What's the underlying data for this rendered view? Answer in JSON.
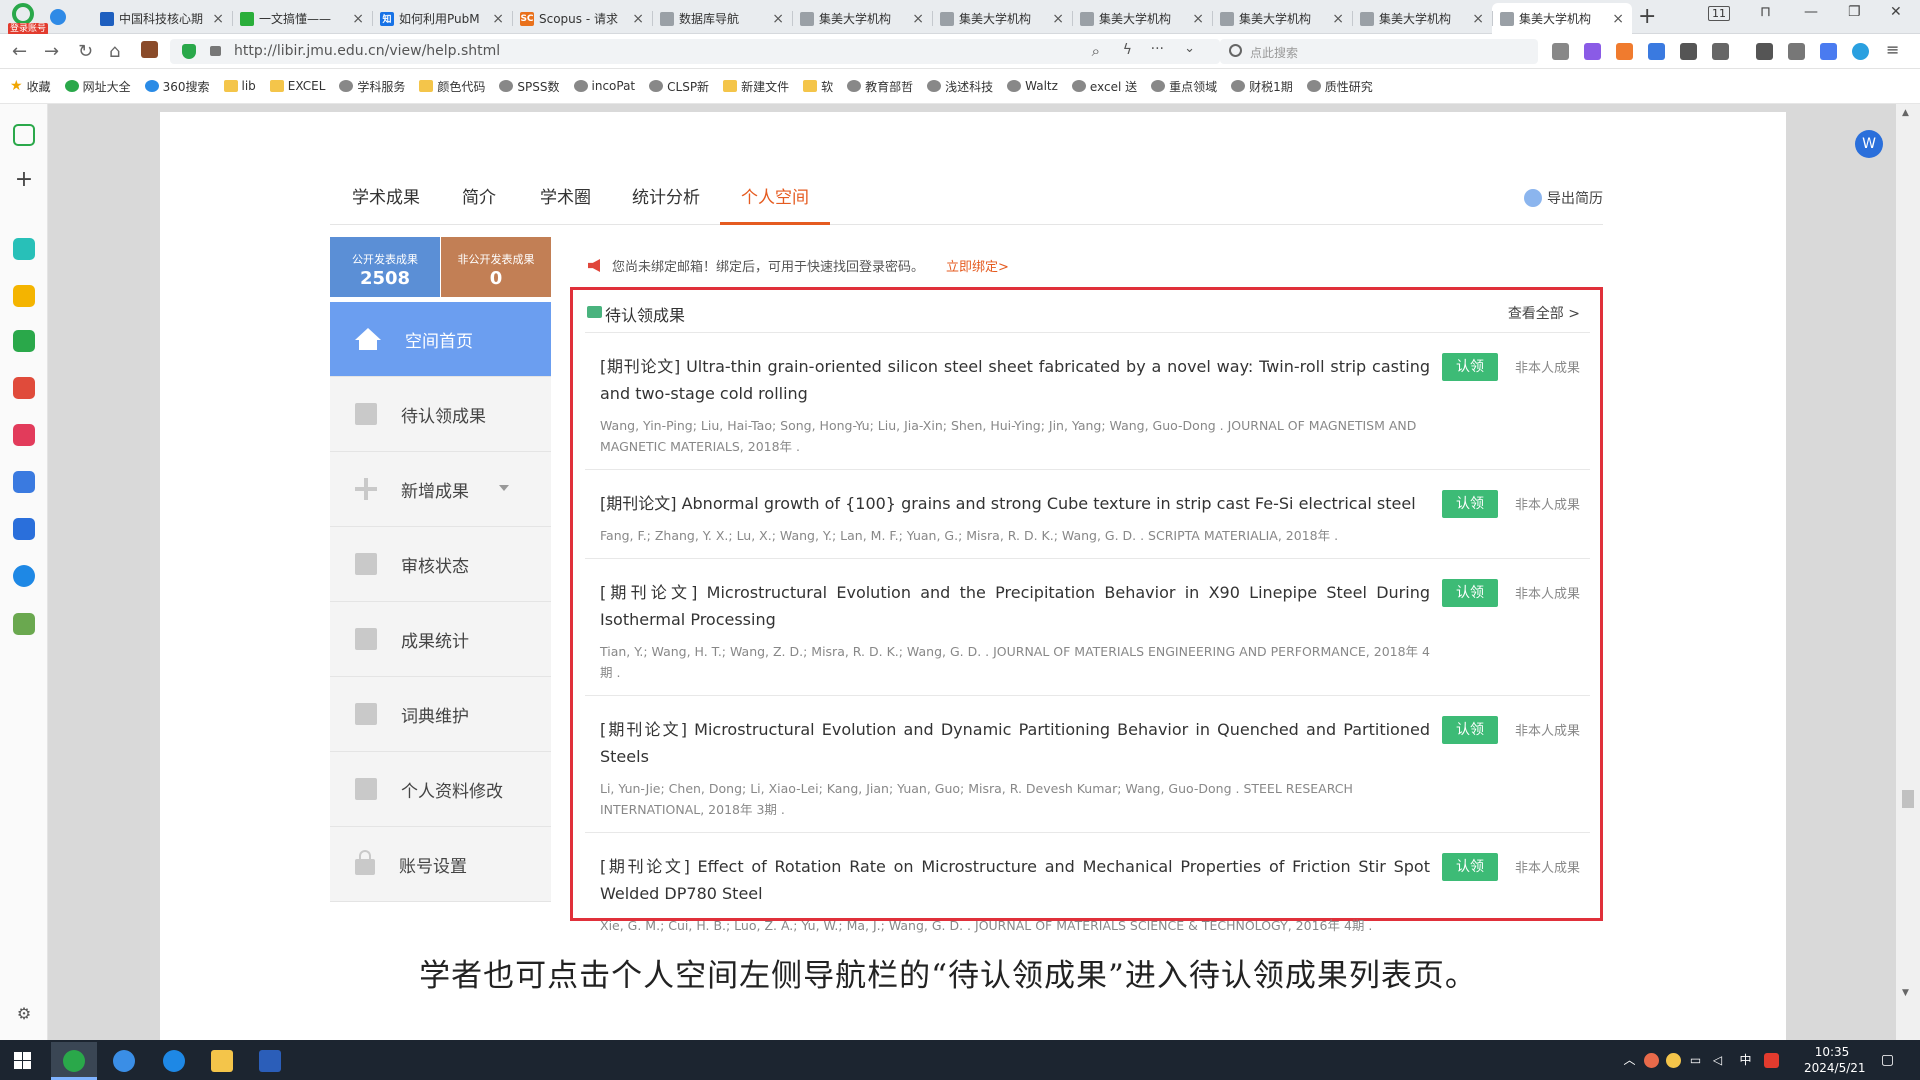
{
  "browser": {
    "login_badge": "登录账号",
    "tabs": [
      {
        "title": "中国科技核心期",
        "icon_color": "#1e5fbf",
        "icon_text": ""
      },
      {
        "title": "一文搞懂——",
        "icon_color": "#2aae3a",
        "icon_text": ""
      },
      {
        "title": "如何利用PubM",
        "icon_color": "#1772e6",
        "icon_text": "知"
      },
      {
        "title": "Scopus - 请求",
        "icon_color": "#e9711c",
        "icon_text": "SC"
      },
      {
        "title": "数据库导航",
        "icon_color": "#9aa0a6",
        "icon_text": ""
      },
      {
        "title": "集美大学机构",
        "icon_color": "#9aa0a6",
        "icon_text": ""
      },
      {
        "title": "集美大学机构",
        "icon_color": "#9aa0a6",
        "icon_text": ""
      },
      {
        "title": "集美大学机构",
        "icon_color": "#9aa0a6",
        "icon_text": ""
      },
      {
        "title": "集美大学机构",
        "icon_color": "#9aa0a6",
        "icon_text": ""
      },
      {
        "title": "集美大学机构",
        "icon_color": "#9aa0a6",
        "icon_text": ""
      },
      {
        "title": "集美大学机构",
        "icon_color": "#9aa0a6",
        "icon_text": "",
        "active": true
      }
    ],
    "new_tab": "+",
    "tab_count": "11",
    "url": "http://libir.jmu.edu.cn/view/help.shtml",
    "search_placeholder": "点此搜索",
    "bookmarks": [
      {
        "label": "收藏",
        "icon": "star"
      },
      {
        "label": "网址大全",
        "icon": "globe"
      },
      {
        "label": "360搜索",
        "icon": "search"
      },
      {
        "label": "lib",
        "icon": "folder"
      },
      {
        "label": "EXCEL",
        "icon": "folder"
      },
      {
        "label": "学科服务",
        "icon": "link"
      },
      {
        "label": "颜色代码",
        "icon": "folder"
      },
      {
        "label": "SPSS数",
        "icon": "link"
      },
      {
        "label": "incoPat",
        "icon": "link"
      },
      {
        "label": "CLSP新",
        "icon": "link"
      },
      {
        "label": "新建文件",
        "icon": "folder"
      },
      {
        "label": "软",
        "icon": "folder"
      },
      {
        "label": "教育部哲",
        "icon": "link"
      },
      {
        "label": "浅述科技",
        "icon": "link"
      },
      {
        "label": "Waltz",
        "icon": "link"
      },
      {
        "label": "excel 送",
        "icon": "link"
      },
      {
        "label": "重点领域",
        "icon": "link"
      },
      {
        "label": "财税1期",
        "icon": "link"
      },
      {
        "label": "质性研究",
        "icon": "link"
      }
    ]
  },
  "site": {
    "tabs": [
      "学术成果",
      "简介",
      "学术圈",
      "统计分析",
      "个人空间"
    ],
    "active_tab": "个人空间",
    "export_label": "导出简历",
    "stats": [
      {
        "label": "公开发表成果",
        "value": "2508"
      },
      {
        "label": "非公开发表成果",
        "value": "0"
      }
    ],
    "nav": [
      {
        "label": "空间首页",
        "icon": "home-icon",
        "active": true
      },
      {
        "label": "待认领成果",
        "icon": "document-icon"
      },
      {
        "label": "新增成果",
        "icon": "plus-icon",
        "has_caret": true
      },
      {
        "label": "审核状态",
        "icon": "document-icon"
      },
      {
        "label": "成果统计",
        "icon": "chart-icon"
      },
      {
        "label": "词典维护",
        "icon": "book-icon"
      },
      {
        "label": "个人资料修改",
        "icon": "edit-icon"
      },
      {
        "label": "账号设置",
        "icon": "lock-icon"
      }
    ],
    "notice": "您尚未绑定邮箱！绑定后，可用于快速找回登录密码。",
    "notice_link": "立即绑定>",
    "panel_title": "待认领成果",
    "view_all": "查看全部 >",
    "claim_label": "认领",
    "not_mine_label": "非本人成果",
    "papers": [
      {
        "title": "[期刊论文] Ultra-thin grain-oriented silicon steel sheet fabricated by a novel way: Twin-roll strip casting and two-stage cold rolling",
        "meta": "Wang, Yin-Ping; Liu, Hai-Tao; Song, Hong-Yu; Liu, Jia-Xin; Shen, Hui-Ying; Jin, Yang; Wang, Guo-Dong . JOURNAL OF MAGNETISM AND MAGNETIC MATERIALS, 2018年 ."
      },
      {
        "title": "[期刊论文] Abnormal growth of {100} grains and strong Cube texture in strip cast Fe-Si electrical steel",
        "meta": "Fang, F.; Zhang, Y. X.; Lu, X.; Wang, Y.; Lan, M. F.; Yuan, G.; Misra, R. D. K.; Wang, G. D. . SCRIPTA MATERIALIA, 2018年 ."
      },
      {
        "title": "[期刊论文] Microstructural Evolution and the Precipitation Behavior in X90 Linepipe Steel During Isothermal Processing",
        "meta": "Tian, Y.; Wang, H. T.; Wang, Z. D.; Misra, R. D. K.; Wang, G. D. . JOURNAL OF MATERIALS ENGINEERING AND PERFORMANCE, 2018年 4期 ."
      },
      {
        "title": "[期刊论文] Microstructural Evolution and Dynamic Partitioning Behavior in Quenched and Partitioned Steels",
        "meta": "Li, Yun-Jie; Chen, Dong; Li, Xiao-Lei; Kang, Jian; Yuan, Guo; Misra, R. Devesh Kumar; Wang, Guo-Dong . STEEL RESEARCH INTERNATIONAL, 2018年 3期 ."
      },
      {
        "title": "[期刊论文] Effect of Rotation Rate on Microstructure and Mechanical Properties of Friction Stir Spot Welded DP780 Steel",
        "meta": "Xie, G. M.; Cui, H. B.; Luo, Z. A.; Yu, W.; Ma, J.; Wang, G. D. . JOURNAL OF MATERIALS SCIENCE & TECHNOLOGY, 2016年 4期 ."
      }
    ]
  },
  "doc_caption": "学者也可点击个人空间左侧导航栏的“待认领成果”进入待认领成果列表页。",
  "taskbar": {
    "time": "10:35",
    "date": "2024/5/21",
    "ime_label": "中"
  },
  "colors": {
    "accent_orange": "#e55b20",
    "highlight_red": "#e0303a",
    "claim_green": "#3dbb76",
    "nav_active_blue": "#6b9ef0"
  }
}
